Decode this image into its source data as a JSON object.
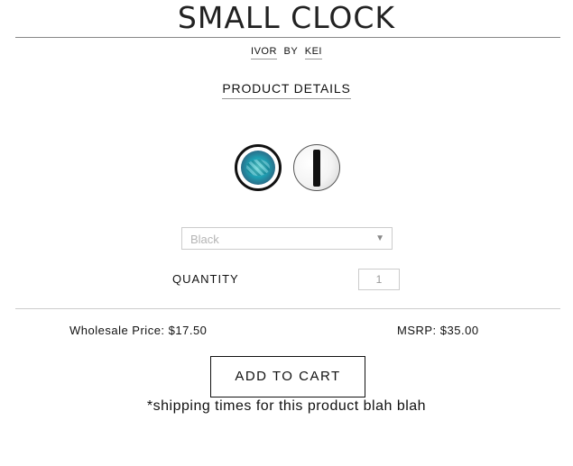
{
  "product": {
    "title": "SMALL CLOCK",
    "brand": "IVOR",
    "by_text": "BY",
    "designer": "KEI",
    "details_link": "PRODUCT DETAILS"
  },
  "swatches": [
    {
      "name": "blue-clock-face-swatch",
      "selected": true
    },
    {
      "name": "black-bar-swatch",
      "selected": false
    }
  ],
  "variant_select": {
    "selected_value": "Black",
    "arrow": "▼"
  },
  "quantity": {
    "label": "QUANTITY",
    "value": "1"
  },
  "pricing": {
    "wholesale": "Wholesale Price: $17.50",
    "msrp": "MSRP: $35.00"
  },
  "cart": {
    "button_label": "ADD TO CART",
    "shipping_note": "*shipping times for this product blah blah"
  }
}
